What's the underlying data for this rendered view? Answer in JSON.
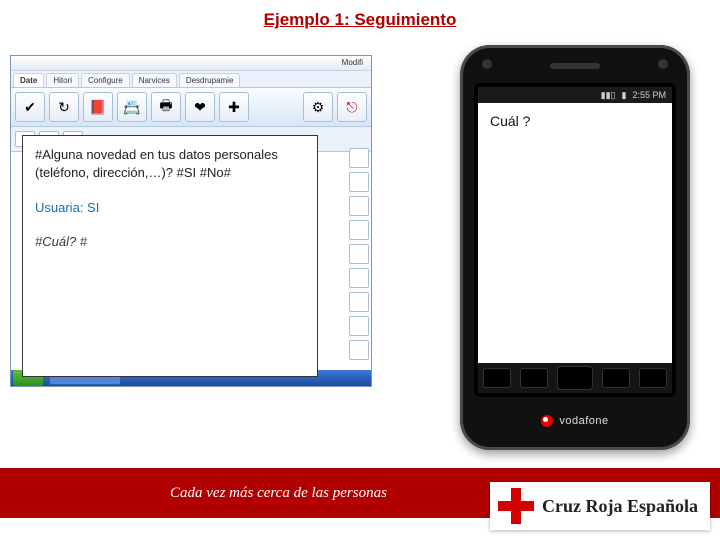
{
  "title": "Ejemplo 1: Seguimiento",
  "app": {
    "top_right": "Modifi",
    "tabs": [
      "Date",
      "Hitori",
      "Configure",
      "Narvices",
      "Desdrupamie"
    ],
    "active_tab": 0,
    "toolbar_icons": [
      "check-icon",
      "refresh-icon",
      "book-icon",
      "card-icon",
      "print-icon",
      "heart-icon",
      "medical-icon"
    ],
    "toolbar_right_icons": [
      "gear-icon",
      "exit-icon"
    ]
  },
  "dialog": {
    "question": "#Alguna novedad en tus datos personales (teléfono, dirección,…)? #SI #No#",
    "user_line": "Usuaria: SI",
    "followup": "#Cuál? #"
  },
  "phone": {
    "status_time": "2:55 PM",
    "message": "Cuál ?",
    "carrier": "vodafone"
  },
  "footer": {
    "slogan": "Cada vez más cerca de las personas",
    "brand": "Cruz Roja Española"
  }
}
